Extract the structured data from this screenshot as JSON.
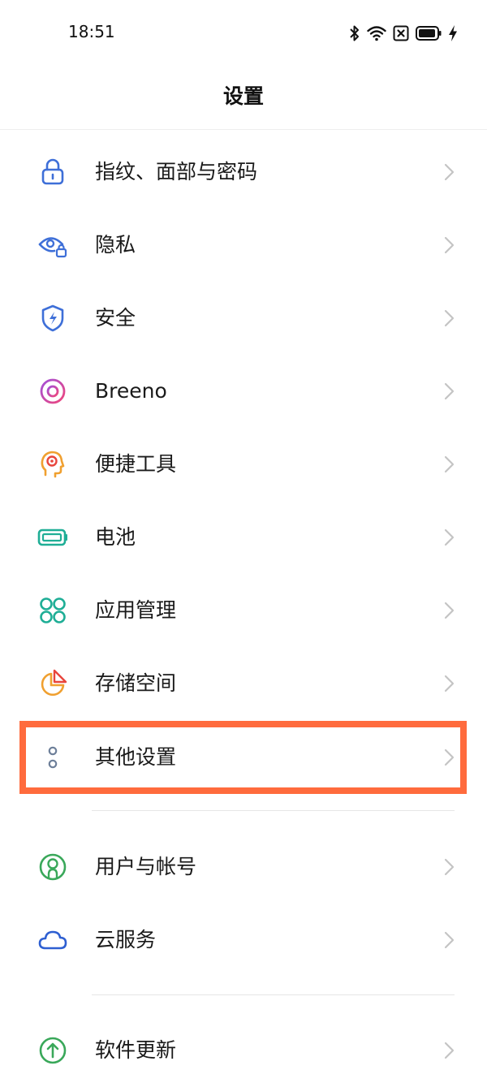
{
  "status_bar": {
    "time": "18:51",
    "icons": [
      "bluetooth-icon",
      "wifi-icon",
      "sim-x-icon",
      "battery-icon",
      "charging-icon"
    ]
  },
  "header": {
    "title": "设置"
  },
  "colors": {
    "highlight": "#ff6b3d",
    "chevron": "#c4c4c4",
    "divider": "#e6e6e6"
  },
  "settings": {
    "items": [
      {
        "label": "指纹、面部与密码",
        "icon": "lock-icon"
      },
      {
        "label": "隐私",
        "icon": "privacy-eye-lock-icon"
      },
      {
        "label": "安全",
        "icon": "shield-bolt-icon"
      },
      {
        "label": "Breeno",
        "icon": "breeno-ring-icon"
      },
      {
        "label": "便捷工具",
        "icon": "head-target-icon"
      },
      {
        "label": "电池",
        "icon": "battery-icon"
      },
      {
        "label": "应用管理",
        "icon": "app-grid-icon"
      },
      {
        "label": "存储空间",
        "icon": "storage-pie-icon"
      },
      {
        "label": "其他设置",
        "icon": "more-dots-icon"
      },
      {
        "label": "用户与帐号",
        "icon": "user-icon"
      },
      {
        "label": "云服务",
        "icon": "cloud-icon"
      },
      {
        "label": "软件更新",
        "icon": "update-arrow-icon"
      }
    ]
  }
}
